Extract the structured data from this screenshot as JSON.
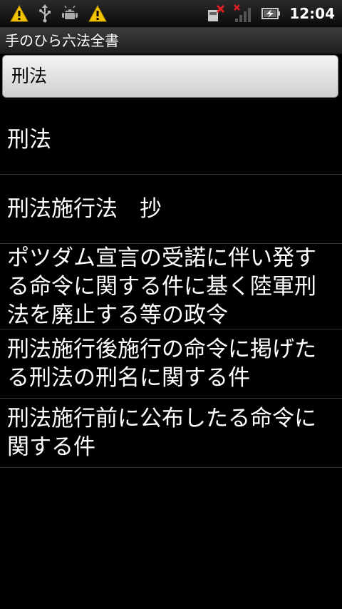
{
  "status_bar": {
    "time": "12:04",
    "icons": [
      "warning-icon",
      "usb-icon",
      "android-debug-icon",
      "warning-icon",
      "sim-error-icon",
      "signal-icon",
      "battery-charging-icon"
    ]
  },
  "app": {
    "title": "手のひら六法全書"
  },
  "selector": {
    "value": "刑法"
  },
  "list": {
    "items": [
      {
        "label": "刑法"
      },
      {
        "label": "刑法施行法　抄"
      },
      {
        "label": "ポツダム宣言の受諾に伴い発する命令に関する件に基く陸軍刑法を廃止する等の政令"
      },
      {
        "label": "刑法施行後施行の命令に掲げたる刑法の刑名に関する件"
      },
      {
        "label": "刑法施行前に公布したる命令に関する件"
      }
    ]
  },
  "colors": {
    "background": "#000000",
    "text": "#ffffff",
    "warning": "#f5c400",
    "divider": "#333333"
  }
}
